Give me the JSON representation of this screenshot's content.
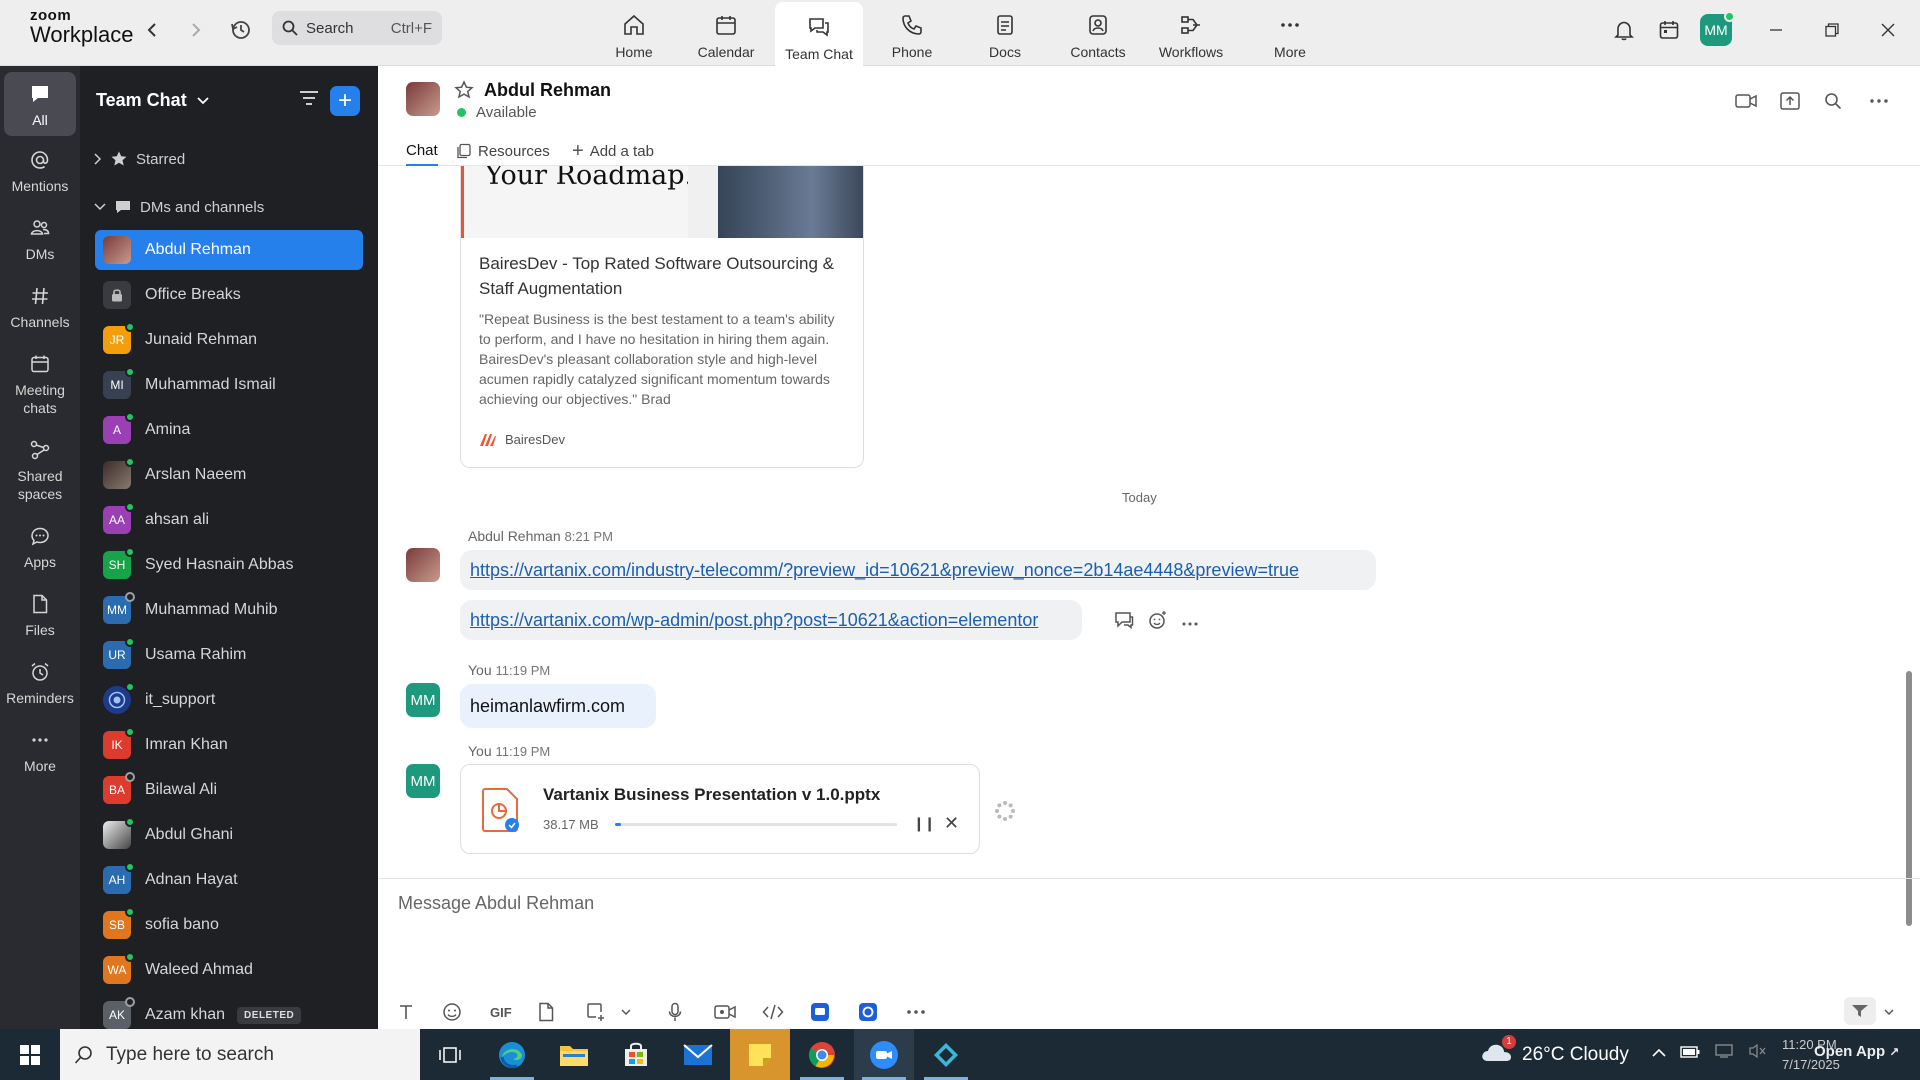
{
  "brand": {
    "line1": "zoom",
    "line2": "Workplace"
  },
  "topbar": {
    "search_label": "Search",
    "search_shortcut": "Ctrl+F",
    "nav": [
      {
        "label": "Home",
        "icon": "home-icon"
      },
      {
        "label": "Calendar",
        "icon": "calendar-icon"
      },
      {
        "label": "Team Chat",
        "icon": "chat-icon",
        "active": true
      },
      {
        "label": "Phone",
        "icon": "phone-icon"
      },
      {
        "label": "Docs",
        "icon": "docs-icon"
      },
      {
        "label": "Contacts",
        "icon": "contacts-icon"
      },
      {
        "label": "Workflows",
        "icon": "workflows-icon"
      },
      {
        "label": "More",
        "icon": "more-icon"
      }
    ],
    "user_initials": "MM"
  },
  "rail": [
    {
      "label": "All",
      "active": true
    },
    {
      "label": "Mentions"
    },
    {
      "label": "DMs"
    },
    {
      "label": "Channels"
    },
    {
      "label": "Meeting chats"
    },
    {
      "label": "Shared spaces"
    },
    {
      "label": "Apps"
    },
    {
      "label": "Files"
    },
    {
      "label": "Reminders"
    },
    {
      "label": "More"
    }
  ],
  "sidebar": {
    "title": "Team Chat",
    "sections": {
      "starred": "Starred",
      "dms": "DMs and channels"
    },
    "items": [
      {
        "name": "Abdul Rehman",
        "initials": "",
        "color": "#7a3b3b",
        "active": true
      },
      {
        "name": "Office Breaks",
        "initials": "",
        "color": "#3a3b40"
      },
      {
        "name": "Junaid Rehman",
        "initials": "JR",
        "color": "#f59e0b"
      },
      {
        "name": "Muhammad Ismail",
        "initials": "MI",
        "color": "#374151"
      },
      {
        "name": "Amina",
        "initials": "A",
        "color": "#9b3fb5"
      },
      {
        "name": "Arslan Naeem",
        "initials": "",
        "color": "#5a4a42"
      },
      {
        "name": "ahsan ali",
        "initials": "AA",
        "color": "#9b3fb5"
      },
      {
        "name": "Syed Hasnain Abbas",
        "initials": "SH",
        "color": "#16a34a"
      },
      {
        "name": "Muhammad Muhib",
        "initials": "MM",
        "color": "#2b6cb0"
      },
      {
        "name": "Usama Rahim",
        "initials": "UR",
        "color": "#2b6cb0"
      },
      {
        "name": "it_support",
        "initials": "",
        "color": "#1e3a8a"
      },
      {
        "name": "Imran Khan",
        "initials": "IK",
        "color": "#dc3b2e"
      },
      {
        "name": "Bilawal Ali",
        "initials": "BA",
        "color": "#dc3b2e"
      },
      {
        "name": "Abdul Ghani",
        "initials": "",
        "color": "#6b6b6b"
      },
      {
        "name": "Adnan Hayat",
        "initials": "AH",
        "color": "#2b6cb0"
      },
      {
        "name": "sofia bano",
        "initials": "SB",
        "color": "#e0761d"
      },
      {
        "name": "Waleed Ahmad",
        "initials": "WA",
        "color": "#e0761d"
      },
      {
        "name": "Azam khan",
        "initials": "AK",
        "color": "#5b5f66",
        "badge": "DELETED"
      }
    ]
  },
  "chat": {
    "contact_name": "Abdul Rehman",
    "status": "Available",
    "tabs": {
      "chat": "Chat",
      "resources": "Resources",
      "add": "Add a tab"
    },
    "link_card": {
      "image_text": "Your Roadmap.",
      "title": "BairesDev - Top Rated Software Outsourcing & Staff Augmentation",
      "description": "\"Repeat Business is the best testament to a team's ability to perform, and I have no hesitation in hiring them again. BairesDev's pleasant collaboration style and high-level acumen rapidly catalyzed significant momentum towards achieving our objectives.\" Brad",
      "source": "BairesDev"
    },
    "date_divider": "Today",
    "messages": [
      {
        "sender": "Abdul Rehman",
        "time": "8:21 PM",
        "links": [
          "https://vartanix.com/industry-telecomm/?preview_id=10621&preview_nonce=2b14ae4448&preview=true",
          "https://vartanix.com/wp-admin/post.php?post=10621&action=elementor"
        ]
      },
      {
        "sender": "You",
        "time": "11:19 PM",
        "initials": "MM",
        "text": "heimanlawfirm.com"
      },
      {
        "sender": "You",
        "time": "11:19 PM",
        "initials": "MM",
        "file": {
          "name": "Vartanix Business Presentation v 1.0.pptx",
          "size": "38.17 MB",
          "progress": 0.02
        }
      }
    ],
    "composer_placeholder": "Message Abdul Rehman",
    "gif_label": "GIF"
  },
  "taskbar": {
    "search_placeholder": "Type here to search",
    "weather": "26°C  Cloudy",
    "weather_badge": "1",
    "time": "11:20 PM",
    "date": "7/17/2025",
    "open_app": "Open App"
  },
  "colors": {
    "accent": "#2680eb",
    "sidebar_bg": "#1f2024",
    "rail_bg": "#2a2b30",
    "online": "#22c55e"
  }
}
